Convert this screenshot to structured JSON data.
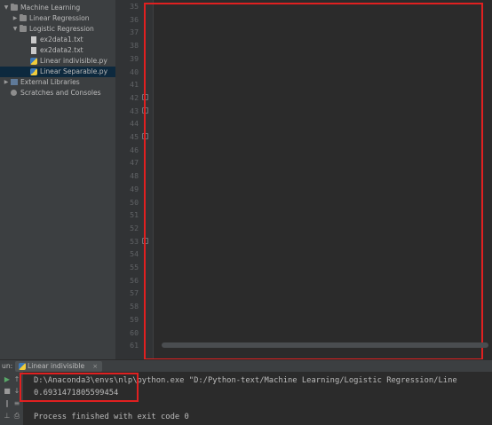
{
  "project_tree": {
    "items": [
      {
        "label": "Machine Learning",
        "icon": "folder-icon",
        "expanded": true
      },
      {
        "label": "Linear Regression",
        "icon": "folder-icon",
        "expanded": false
      },
      {
        "label": "Logistic Regression",
        "icon": "folder-icon",
        "expanded": true
      },
      {
        "label": "ex2data1.txt",
        "icon": "text-file-icon"
      },
      {
        "label": "ex2data2.txt",
        "icon": "text-file-icon"
      },
      {
        "label": "Linear indivisible.py",
        "icon": "python-file-icon"
      },
      {
        "label": "Linear Separable.py",
        "icon": "python-file-icon",
        "selected": true
      },
      {
        "label": "External Libraries",
        "icon": "library-icon",
        "expanded": false
      },
      {
        "label": "Scratches and Consoles",
        "icon": "scratch-icon"
      }
    ]
  },
  "editor": {
    "line_numbers": [
      "35",
      "36",
      "37",
      "38",
      "39",
      "40",
      "41",
      "42",
      "43",
      "44",
      "45",
      "46",
      "47",
      "48",
      "49",
      "50",
      "51",
      "52",
      "53",
      "54",
      "55",
      "56",
      "57",
      "58",
      "59",
      "60",
      "61"
    ]
  },
  "run_panel": {
    "title": "un:",
    "tab_label": "Linear indivisible",
    "tab_close": "×",
    "command": "D:\\Anaconda3\\envs\\nlp\\python.exe \"D:/Python-text/Machine Learning/Logistic Regression/Line",
    "result": "0.6931471805599454",
    "exit_message": "Process finished with exit code 0"
  },
  "colors": {
    "keyword": "#cc7832",
    "function": "#ffc66d",
    "number": "#6897bb",
    "comment": "#808080",
    "annotation_box": "#e02020"
  }
}
